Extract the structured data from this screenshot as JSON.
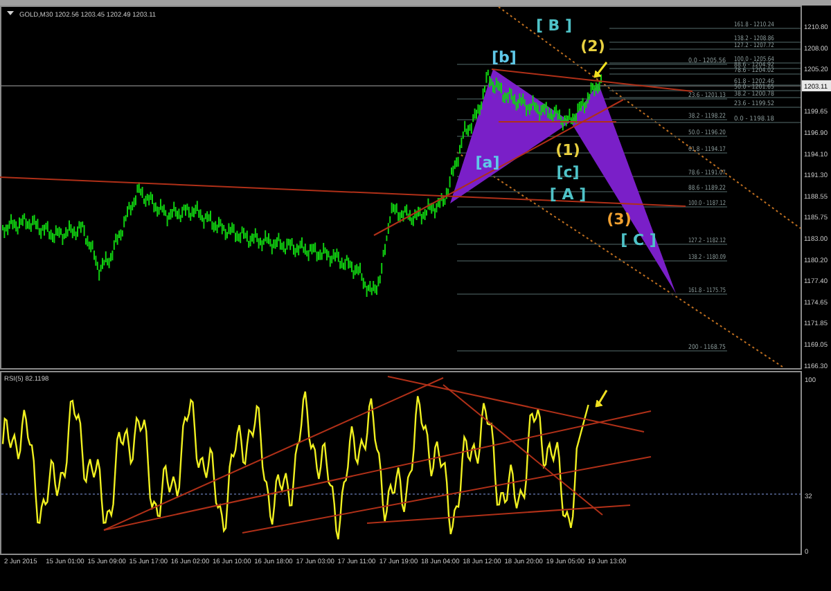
{
  "chart_header": "GOLD,M30  1202.56 1203.45 1202.49 1203.11",
  "price_axis": {
    "labels": [
      "1210.80",
      "1208.00",
      "1205.20",
      "1199.65",
      "1196.90",
      "1194.10",
      "1191.30",
      "1188.55",
      "1185.75",
      "1183.00",
      "1180.20",
      "1177.40",
      "1174.65",
      "1171.85",
      "1169.05",
      "1166.30"
    ],
    "current_price": "1203.11"
  },
  "wave_labels": [
    {
      "text": "[ B ]",
      "color": "#4fc3c8"
    },
    {
      "text": "(2)",
      "color": "#e8d040"
    },
    {
      "text": "[b]",
      "color": "#5fc8e8"
    },
    {
      "text": "[a]",
      "color": "#5fc8e8"
    },
    {
      "text": "(1)",
      "color": "#e8d040"
    },
    {
      "text": "[c]",
      "color": "#4fc3c8"
    },
    {
      "text": "[ A ]",
      "color": "#4fc3c8"
    },
    {
      "text": "(3)",
      "color": "#f0a030"
    },
    {
      "text": "[ C ]",
      "color": "#4fc3c8"
    }
  ],
  "fib_levels_right": [
    "161.8 - 1210.24",
    "138.2 - 1208.86",
    "127.2 - 1207.72",
    "100.0 - 1205.64",
    "88.6 - 1204.92",
    "78.6 - 1204.02",
    "61.8 - 1202.46",
    "50.0 - 1201.65",
    "38.2 - 1200.78",
    "23.6 - 1199.52",
    "0.0 - 1198.18"
  ],
  "fib_levels_middle": [
    "0.0 - 1205.56",
    "23.6 - 1201.13",
    "38.2 - 1198.22",
    "50.0 - 1196.20",
    "61.8 - 1194.17",
    "78.6 - 1191.07",
    "88.6 - 1189.22",
    "100.0 - 1187.12",
    "127.2 - 1182.12",
    "138.2 - 1180.09",
    "161.8 - 1175.75",
    "200 - 1168.75"
  ],
  "rsi": {
    "title": "RSI(5) 82.1198",
    "axis": [
      "100",
      "32",
      "0"
    ]
  },
  "time_axis": [
    "2 Jun 2015",
    "15 Jun 01:00",
    "15 Jun 09:00",
    "15 Jun 17:00",
    "16 Jun 02:00",
    "16 Jun 10:00",
    "16 Jun 18:00",
    "17 Jun 03:00",
    "17 Jun 11:00",
    "17 Jun 19:00",
    "18 Jun 04:00",
    "18 Jun 12:00",
    "18 Jun 20:00",
    "19 Jun 05:00",
    "19 Jun 13:00"
  ]
}
